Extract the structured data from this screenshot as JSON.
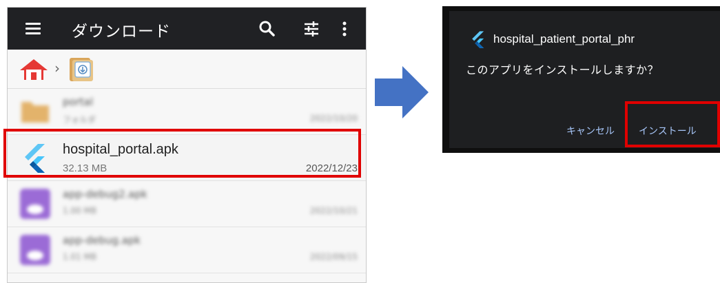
{
  "left_screen": {
    "appbar": {
      "title": "ダウンロード",
      "icons": [
        "menu-icon",
        "search-icon",
        "tune-icon",
        "more-vert-icon"
      ],
      "background": "#202124"
    },
    "breadcrumb": {
      "icons": [
        "home-icon",
        "chevron-right-icon",
        "download-folder-icon"
      ]
    },
    "files": [
      {
        "name": "portal",
        "sub": "フォルダ",
        "date": "2022/10/20",
        "blurred": true,
        "thumb": "folder-icon"
      },
      {
        "name": "hospital_portal.apk",
        "sub": "32.13 MB",
        "date": "2022/12/23",
        "blurred": false,
        "thumb": "flutter-icon"
      },
      {
        "name": "app-debug2.apk",
        "sub": "1.00 MB",
        "date": "2022/10/21",
        "blurred": true,
        "thumb": "app-icon"
      },
      {
        "name": "app-debug.apk",
        "sub": "1.01 MB",
        "date": "2022/09/15",
        "blurred": true,
        "thumb": "app-icon"
      }
    ]
  },
  "arrow": {
    "icon": "right-arrow-icon",
    "color": "#4472c4"
  },
  "dialog": {
    "app_name": "hospital_patient_portal_phr",
    "question": "このアプリをインストールしますか？",
    "cancel_label": "キャンセル",
    "install_label": "インストール",
    "background": "#1e1f21",
    "button_color": "#a8c7fa"
  },
  "highlight_color": "#e00000"
}
